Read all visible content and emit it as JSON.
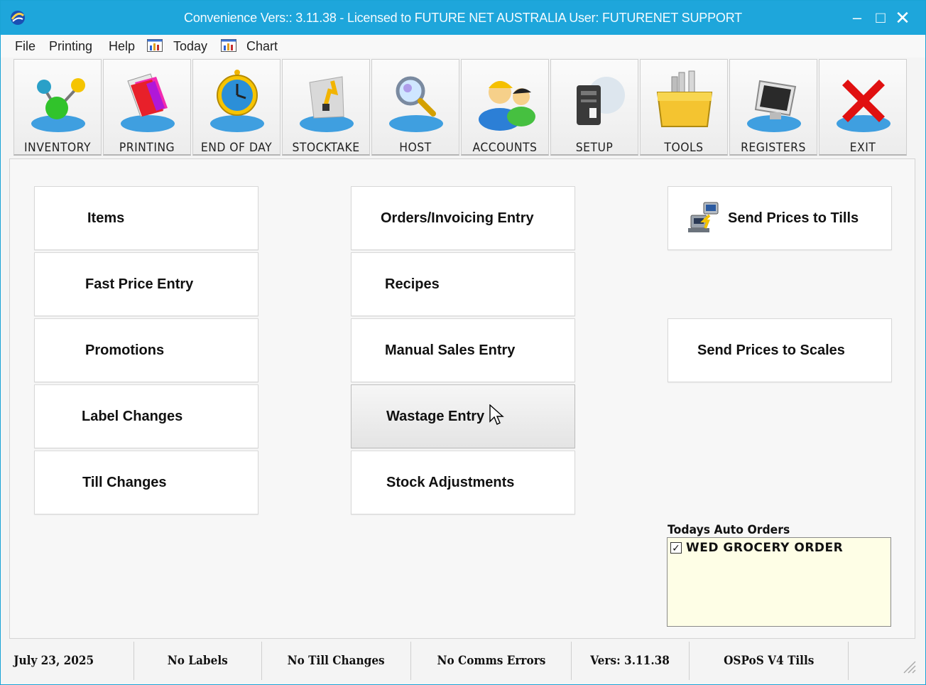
{
  "window": {
    "title": "Convenience Vers:: 3.11.38 - Licensed to FUTURE NET AUSTRALIA  User: FUTURENET SUPPORT",
    "controls": {
      "minimize": "–",
      "maximize": "□",
      "close": "✕"
    }
  },
  "menu": {
    "file": "File",
    "printing": "Printing",
    "help": "Help",
    "today": "Today",
    "chart": "Chart"
  },
  "toolbar": {
    "items": [
      {
        "label": "INVENTORY",
        "icon": "inventory-icon"
      },
      {
        "label": "PRINTING",
        "icon": "printing-icon"
      },
      {
        "label": "END OF DAY",
        "icon": "end-of-day-clock-icon"
      },
      {
        "label": "STOCKTAKE",
        "icon": "stocktake-icon"
      },
      {
        "label": "HOST",
        "icon": "host-magnifier-icon"
      },
      {
        "label": "ACCOUNTS",
        "icon": "accounts-users-icon"
      },
      {
        "label": "SETUP",
        "icon": "setup-computer-icon"
      },
      {
        "label": "TOOLS",
        "icon": "tools-toolbox-icon"
      },
      {
        "label": "REGISTERS",
        "icon": "registers-monitor-icon"
      },
      {
        "label": "EXIT",
        "icon": "exit-x-icon"
      }
    ]
  },
  "actions": {
    "left": [
      "Items",
      "Fast Price Entry",
      "Promotions",
      "Label Changes",
      "Till Changes"
    ],
    "middle": [
      "Orders/Invoicing Entry",
      "Recipes",
      "Manual Sales Entry",
      "Wastage Entry",
      "Stock Adjustments"
    ],
    "send_tills": "Send Prices to Tills",
    "send_scales": "Send Prices to Scales"
  },
  "auto_orders": {
    "label": "Todays Auto Orders",
    "items": [
      {
        "text": "WED GROCERY ORDER",
        "checked": true,
        "check_glyph": "✓"
      }
    ]
  },
  "status": {
    "date": "July 23, 2025",
    "labels": "No Labels",
    "till_changes": "No Till Changes",
    "comms": "No Comms Errors",
    "version": "Vers: 3.11.38",
    "tills": "OSPoS V4 Tills"
  },
  "colors": {
    "titlebar": "#1ea6db",
    "auto_orders_bg": "#fefee6"
  }
}
